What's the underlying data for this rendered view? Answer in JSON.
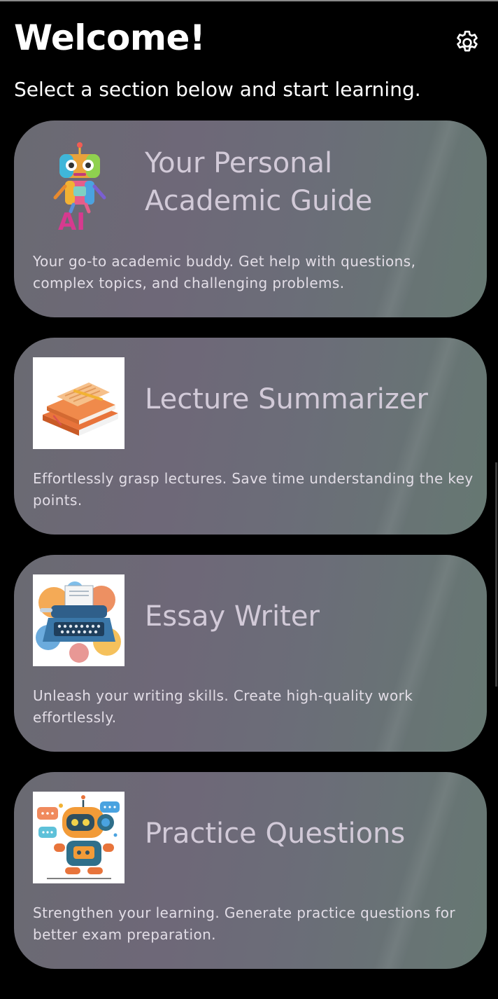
{
  "header": {
    "title": "Welcome!",
    "subtitle": "Select a section below and start learning.",
    "settings_icon": "gear-icon"
  },
  "cards": [
    {
      "title": "Your Personal Academic Guide",
      "description": "Your go-to academic buddy. Get help with questions, complex topics, and challenging problems.",
      "icon": "ai-robot-icon",
      "image_text": "AI"
    },
    {
      "title": "Lecture Summarizer",
      "description": "Effortlessly grasp lectures. Save time understanding the key points.",
      "icon": "books-notepad-icon"
    },
    {
      "title": "Essay Writer",
      "description": "Unleash your writing skills. Create high-quality work effortlessly.",
      "icon": "typewriter-icon"
    },
    {
      "title": "Practice Questions",
      "description": "Strengthen your learning. Generate practice questions for better exam preparation.",
      "icon": "chat-robot-icon"
    }
  ],
  "colors": {
    "background": "#000000",
    "card_gradient_start": "#6a6a72",
    "card_gradient_end": "#667872",
    "card_title": "#d2cad8",
    "card_text": "#e2dde6"
  }
}
